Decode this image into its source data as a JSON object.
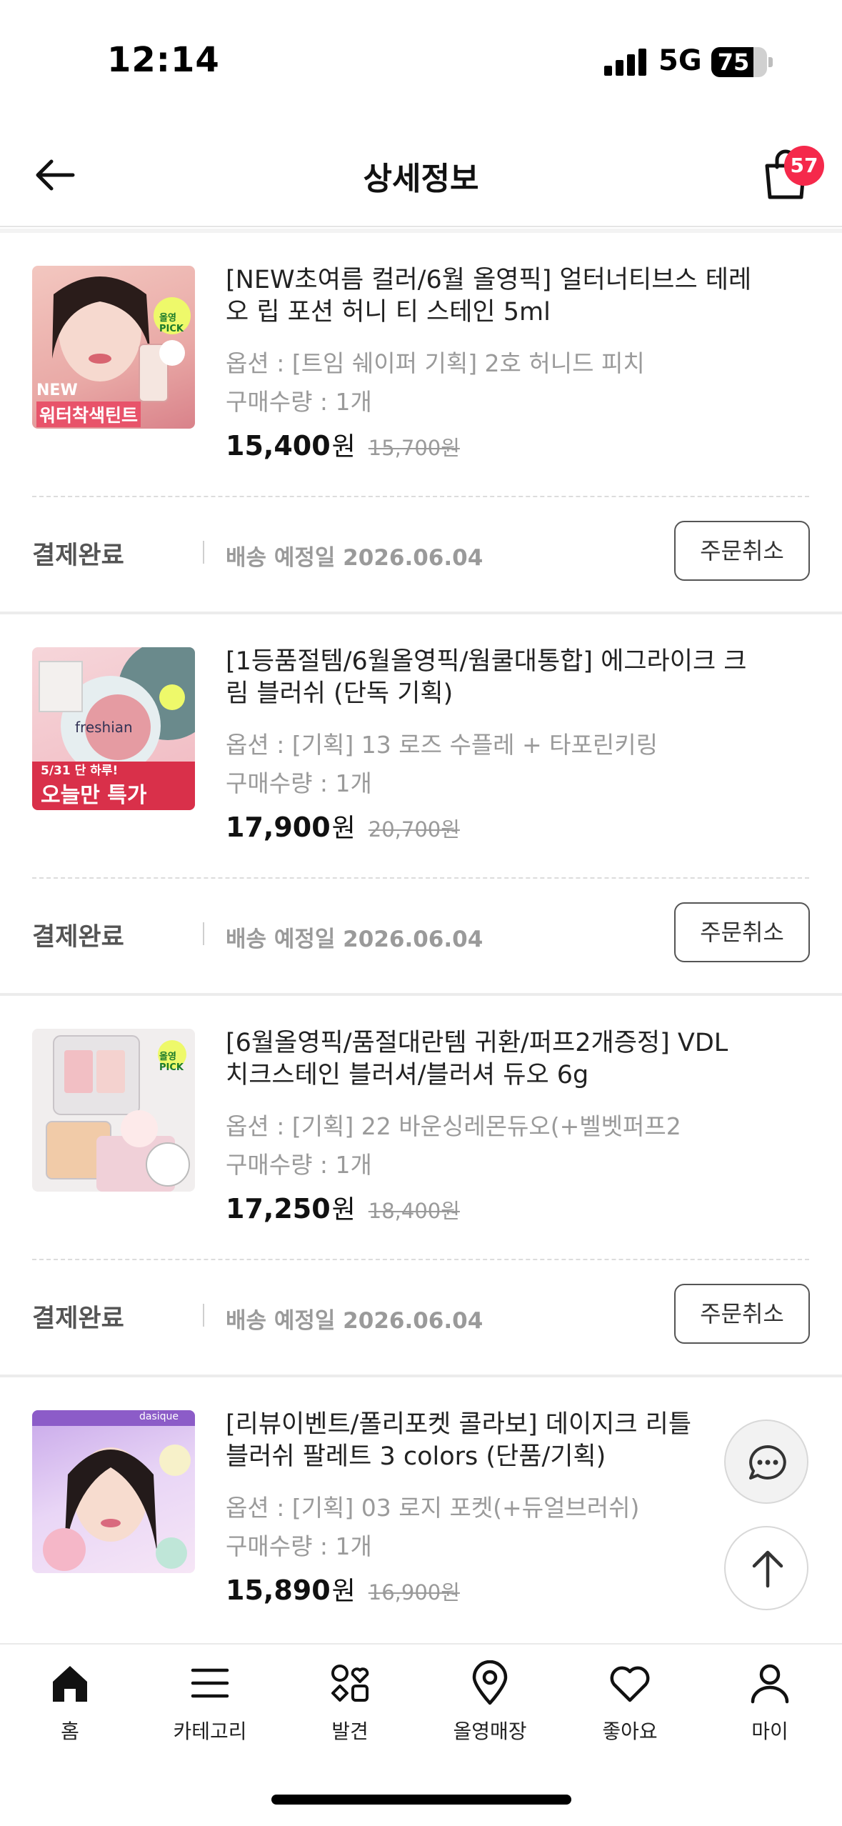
{
  "status_bar": {
    "time": "12:14",
    "network": "5G",
    "battery": "75",
    "battery_level": 0.75
  },
  "header": {
    "title": "상세정보",
    "cart_count": "57"
  },
  "colors": {
    "badge": "#f5294b",
    "text_primary": "#111111",
    "text_muted": "#9a9a9a"
  },
  "products": [
    {
      "title": "[NEW초여름 컬러/6월 올영픽] 얼터너티브스 테레오 립 포션 허니 티 스테인 5ml",
      "option": "옵션 : [트임 쉐이퍼 기획] 2호 허니드 피치",
      "quantity": "구매수량 : 1개",
      "price": "15,400",
      "price_unit": "원",
      "original_price": "15,700원",
      "status": "결제완료",
      "delivery": "배송 예정일 2026.06.04",
      "cancel_label": "주문취소",
      "thumb": {
        "tag": "올영PICK",
        "line1": "NEW",
        "line2": "워터착색틴트"
      }
    },
    {
      "title": "[1등품절템/6월올영픽/웜쿨대통합] 에그라이크 크림 블러쉬 (단독 기획)",
      "option": "옵션 : [기획] 13 로즈 수플레 + 타포린키링",
      "quantity": "구매수량 : 1개",
      "price": "17,900",
      "price_unit": "원",
      "original_price": "20,700원",
      "status": "결제완료",
      "delivery": "배송 예정일 2026.06.04",
      "cancel_label": "주문취소",
      "thumb": {
        "brand": "freshian",
        "line1": "5/31 단 하루!",
        "line2": "오늘만 특가"
      }
    },
    {
      "title": "[6월올영픽/품절대란템 귀환/퍼프2개증정] VDL 치크스테인 블러셔/블러셔 듀오 6g",
      "option": "옵션 : [기획] 22 바운싱레몬듀오(+벨벳퍼프2",
      "quantity": "구매수량 : 1개",
      "price": "17,250",
      "price_unit": "원",
      "original_price": "18,400원",
      "status": "결제완료",
      "delivery": "배송 예정일 2026.06.04",
      "cancel_label": "주문취소",
      "thumb": {
        "tag": "올영PICK"
      }
    },
    {
      "title": "[리뷰이벤트/폴리포켓 콜라보] 데이지크 리틀 블러쉬 팔레트 3 colors (단품/기획)",
      "option": "옵션 : [기획] 03 로지 포켓(+듀얼브러쉬)",
      "quantity": "구매수량 : 1개",
      "price": "15,890",
      "price_unit": "원",
      "original_price": "16,900원",
      "thumb": {
        "brand": "dasique"
      }
    }
  ],
  "bottom_nav": [
    {
      "label": "홈",
      "icon": "home-icon"
    },
    {
      "label": "카테고리",
      "icon": "menu-icon"
    },
    {
      "label": "발견",
      "icon": "discover-icon"
    },
    {
      "label": "올영매장",
      "icon": "location-pin-icon"
    },
    {
      "label": "좋아요",
      "icon": "heart-icon"
    },
    {
      "label": "마이",
      "icon": "user-icon"
    }
  ]
}
